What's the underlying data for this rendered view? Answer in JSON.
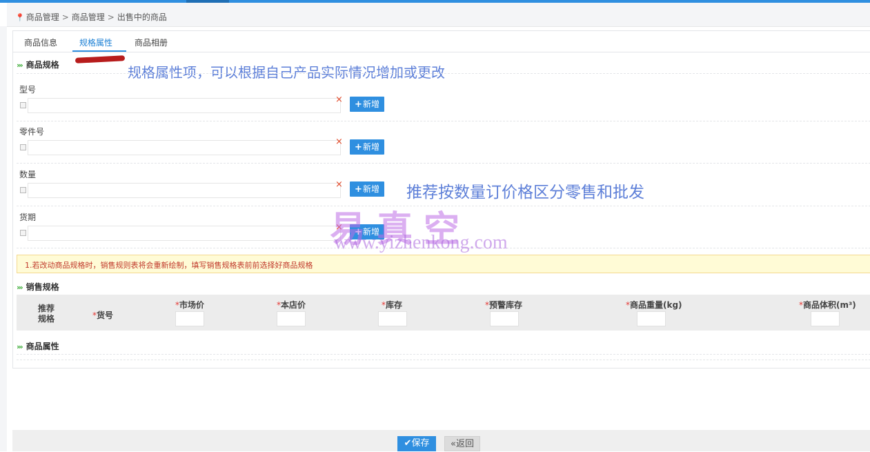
{
  "breadcrumb": {
    "icon": "map-pin-icon",
    "items": [
      "商品管理",
      "商品管理",
      "出售中的商品"
    ],
    "separator": ">"
  },
  "tabs": [
    {
      "label": "商品信息",
      "active": false
    },
    {
      "label": "规格属性",
      "active": true
    },
    {
      "label": "商品相册",
      "active": false
    }
  ],
  "sections": {
    "spec_title": "商品规格",
    "sales_title": "销售规格",
    "attr_title": "商品属性"
  },
  "annotations": {
    "top": "规格属性项，可以根据自己产品实际情况增加或更改",
    "middle": "推荐按数量订价格区分零售和批发"
  },
  "spec_rows": [
    {
      "label": "型号",
      "value": ""
    },
    {
      "label": "零件号",
      "value": ""
    },
    {
      "label": "数量",
      "value": ""
    },
    {
      "label": "货期",
      "value": ""
    }
  ],
  "add_button_label": "新增",
  "delete_symbol": "×",
  "watermark": {
    "text": "易真空",
    "url": "www.yizhenkong.com"
  },
  "warning": "1.若改动商品规格时，销售规则表将会重新绘制，填写销售规格表前前选择好商品规格",
  "sales_table": {
    "columns": [
      {
        "label": "推荐\n规格",
        "required": false
      },
      {
        "label": "货号",
        "required": true
      },
      {
        "label": "市场价",
        "required": true
      },
      {
        "label": "本店价",
        "required": true
      },
      {
        "label": "库存",
        "required": true
      },
      {
        "label": "预警库存",
        "required": true
      },
      {
        "label": "商品重量(kg)",
        "required": true
      },
      {
        "label": "商品体积(m³)",
        "required": true
      }
    ]
  },
  "footer": {
    "save_label": "保存",
    "back_label": "«返回"
  },
  "colors": {
    "primary": "#2f8fe0",
    "chevron": "#3aaa35",
    "warning_text": "#c0392b",
    "required": "#e53935",
    "annotation": "#5d7fd8"
  }
}
